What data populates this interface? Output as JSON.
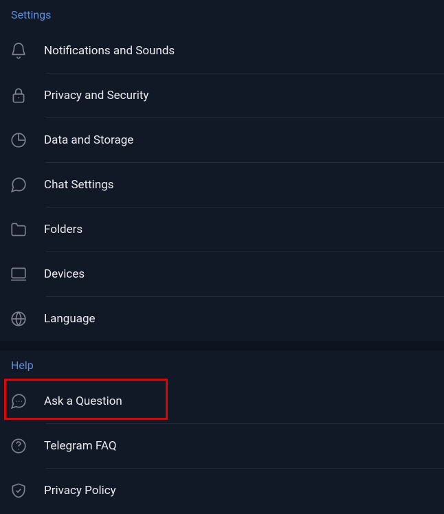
{
  "sections": {
    "settings": {
      "title": "Settings",
      "items": [
        {
          "label": "Notifications and Sounds",
          "icon": "bell-icon"
        },
        {
          "label": "Privacy and Security",
          "icon": "lock-icon"
        },
        {
          "label": "Data and Storage",
          "icon": "pie-icon"
        },
        {
          "label": "Chat Settings",
          "icon": "chat-icon"
        },
        {
          "label": "Folders",
          "icon": "folder-icon"
        },
        {
          "label": "Devices",
          "icon": "monitor-icon"
        },
        {
          "label": "Language",
          "icon": "globe-icon"
        }
      ]
    },
    "help": {
      "title": "Help",
      "items": [
        {
          "label": "Ask a Question",
          "icon": "chat-dots-icon",
          "highlighted": true
        },
        {
          "label": "Telegram FAQ",
          "icon": "question-icon"
        },
        {
          "label": "Privacy Policy",
          "icon": "shield-check-icon"
        }
      ]
    }
  }
}
